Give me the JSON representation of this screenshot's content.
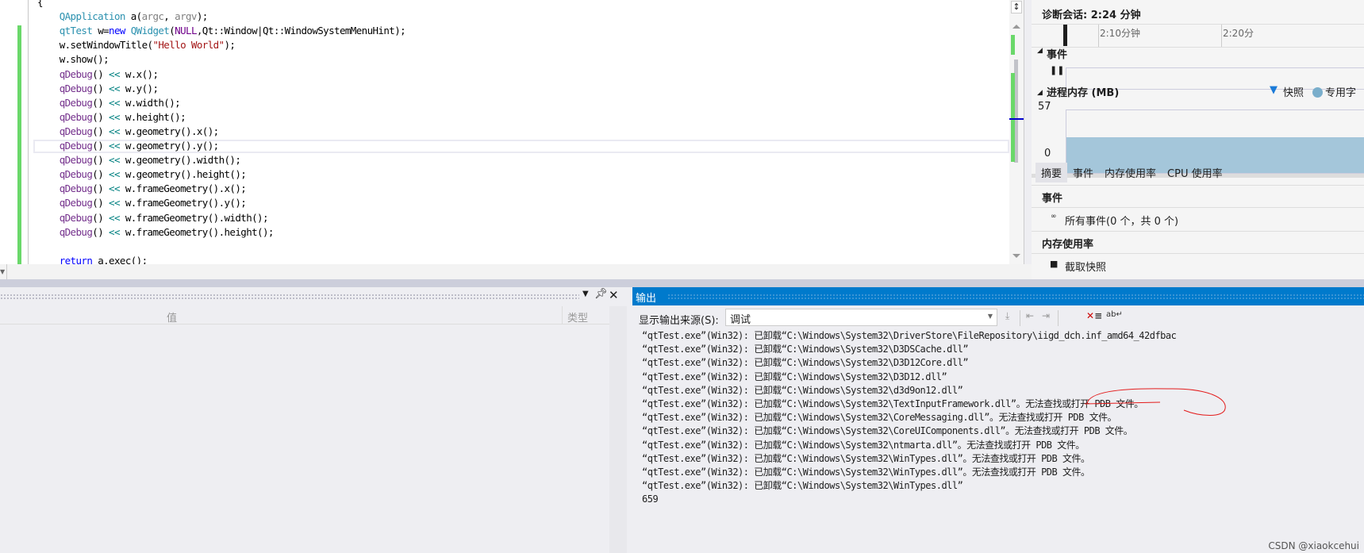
{
  "editor": {
    "lines": [
      [
        {
          "t": "{",
          "c": "plain"
        }
      ],
      [
        {
          "t": "    QApplication",
          "c": "type"
        },
        {
          "t": " a(",
          "c": "plain"
        },
        {
          "t": "argc",
          "c": "param"
        },
        {
          "t": ", ",
          "c": "plain"
        },
        {
          "t": "argv",
          "c": "param"
        },
        {
          "t": ");",
          "c": "plain"
        }
      ],
      [
        {
          "t": "    qtTest",
          "c": "type"
        },
        {
          "t": " w=",
          "c": "plain"
        },
        {
          "t": "new",
          "c": "kw"
        },
        {
          "t": " QWidget",
          "c": "type"
        },
        {
          "t": "(",
          "c": "plain"
        },
        {
          "t": "NULL",
          "c": "macro"
        },
        {
          "t": ",Qt::Window|Qt::WindowSystemMenuHint);",
          "c": "plain"
        }
      ],
      [
        {
          "t": "    w.setWindowTitle(",
          "c": "plain"
        },
        {
          "t": "\"Hello World\"",
          "c": "str"
        },
        {
          "t": ");",
          "c": "plain"
        }
      ],
      [
        {
          "t": "    w.show();",
          "c": "plain"
        }
      ],
      [
        {
          "t": "    qDebug",
          "c": "fn"
        },
        {
          "t": "() ",
          "c": "plain"
        },
        {
          "t": "<<",
          "c": "op"
        },
        {
          "t": " w.x();",
          "c": "plain"
        }
      ],
      [
        {
          "t": "    qDebug",
          "c": "fn"
        },
        {
          "t": "() ",
          "c": "plain"
        },
        {
          "t": "<<",
          "c": "op"
        },
        {
          "t": " w.y();",
          "c": "plain"
        }
      ],
      [
        {
          "t": "    qDebug",
          "c": "fn"
        },
        {
          "t": "() ",
          "c": "plain"
        },
        {
          "t": "<<",
          "c": "op"
        },
        {
          "t": " w.width();",
          "c": "plain"
        }
      ],
      [
        {
          "t": "    qDebug",
          "c": "fn"
        },
        {
          "t": "() ",
          "c": "plain"
        },
        {
          "t": "<<",
          "c": "op"
        },
        {
          "t": " w.height();",
          "c": "plain"
        }
      ],
      [
        {
          "t": "    qDebug",
          "c": "fn"
        },
        {
          "t": "() ",
          "c": "plain"
        },
        {
          "t": "<<",
          "c": "op"
        },
        {
          "t": " w.geometry().x();",
          "c": "plain"
        }
      ],
      [
        {
          "t": "    qDebug",
          "c": "fn"
        },
        {
          "t": "() ",
          "c": "plain"
        },
        {
          "t": "<<",
          "c": "op"
        },
        {
          "t": " w.geometry().y();",
          "c": "plain"
        }
      ],
      [
        {
          "t": "    qDebug",
          "c": "fn"
        },
        {
          "t": "() ",
          "c": "plain"
        },
        {
          "t": "<<",
          "c": "op"
        },
        {
          "t": " w.geometry().width();",
          "c": "plain"
        }
      ],
      [
        {
          "t": "    qDebug",
          "c": "fn"
        },
        {
          "t": "() ",
          "c": "plain"
        },
        {
          "t": "<<",
          "c": "op"
        },
        {
          "t": " w.geometry().height();",
          "c": "plain"
        }
      ],
      [
        {
          "t": "    qDebug",
          "c": "fn"
        },
        {
          "t": "() ",
          "c": "plain"
        },
        {
          "t": "<<",
          "c": "op"
        },
        {
          "t": " w.frameGeometry().x();",
          "c": "plain"
        }
      ],
      [
        {
          "t": "    qDebug",
          "c": "fn"
        },
        {
          "t": "() ",
          "c": "plain"
        },
        {
          "t": "<<",
          "c": "op"
        },
        {
          "t": " w.frameGeometry().y();",
          "c": "plain"
        }
      ],
      [
        {
          "t": "    qDebug",
          "c": "fn"
        },
        {
          "t": "() ",
          "c": "plain"
        },
        {
          "t": "<<",
          "c": "op"
        },
        {
          "t": " w.frameGeometry().width();",
          "c": "plain"
        }
      ],
      [
        {
          "t": "    qDebug",
          "c": "fn"
        },
        {
          "t": "() ",
          "c": "plain"
        },
        {
          "t": "<<",
          "c": "op"
        },
        {
          "t": " w.frameGeometry().height();",
          "c": "plain"
        }
      ],
      [
        {
          "t": "",
          "c": "plain"
        }
      ],
      [
        {
          "t": "    return",
          "c": "kw"
        },
        {
          "t": " a.exec();",
          "c": "plain"
        }
      ]
    ]
  },
  "diagnostics": {
    "session": "诊断会话: 2:24 分钟",
    "ticks": [
      "2:10分钟",
      "2:20分"
    ],
    "events_title": "事件",
    "memory_title": "进程内存 (MB)",
    "legend_snapshot": "快照",
    "legend_private": "专用字",
    "y_max": "57",
    "y_min": "0",
    "memory_fill_fraction": 0.72,
    "tabs": [
      "摘要",
      "事件",
      "内存使用率",
      "CPU 使用率"
    ],
    "events_section": "事件",
    "events_summary": "所有事件(0 个，共 0 个)",
    "memory_section": "内存使用率",
    "snapshot_button": "截取快照"
  },
  "locals": {
    "col_value": "值",
    "col_type": "类型"
  },
  "output": {
    "title": "输出",
    "source_label": "显示输出来源(S):",
    "source_value": "调试",
    "lines": [
      "“qtTest.exe”(Win32): 已卸载“C:\\Windows\\System32\\DriverStore\\FileRepository\\iigd_dch.inf_amd64_42dfbac",
      "“qtTest.exe”(Win32): 已卸载“C:\\Windows\\System32\\D3DSCache.dll”",
      "“qtTest.exe”(Win32): 已卸载“C:\\Windows\\System32\\D3D12Core.dll”",
      "“qtTest.exe”(Win32): 已卸载“C:\\Windows\\System32\\D3D12.dll”",
      "“qtTest.exe”(Win32): 已卸载“C:\\Windows\\System32\\d3d9on12.dll”",
      "“qtTest.exe”(Win32): 已加载“C:\\Windows\\System32\\TextInputFramework.dll”。无法查找或打开 PDB 文件。",
      "“qtTest.exe”(Win32): 已加载“C:\\Windows\\System32\\CoreMessaging.dll”。无法查找或打开 PDB 文件。",
      "“qtTest.exe”(Win32): 已加载“C:\\Windows\\System32\\CoreUIComponents.dll”。无法查找或打开 PDB 文件。",
      "“qtTest.exe”(Win32): 已加载“C:\\Windows\\System32\\ntmarta.dll”。无法查找或打开 PDB 文件。",
      "“qtTest.exe”(Win32): 已加载“C:\\Windows\\System32\\WinTypes.dll”。无法查找或打开 PDB 文件。",
      "“qtTest.exe”(Win32): 已加载“C:\\Windows\\System32\\WinTypes.dll”。无法查找或打开 PDB 文件。",
      "“qtTest.exe”(Win32): 已卸载“C:\\Windows\\System32\\WinTypes.dll”",
      "659"
    ]
  },
  "watermark": "CSDN @xiaokcehui"
}
